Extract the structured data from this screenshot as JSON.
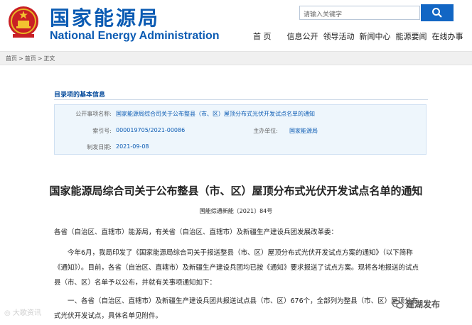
{
  "header": {
    "title_cn": "国家能源局",
    "title_en": "National Energy Administration",
    "search_placeholder": "请输入关键字"
  },
  "nav": {
    "items": [
      "首 页",
      "信息公开",
      "领导活动",
      "新闻中心",
      "能源要闻",
      "在线办事"
    ]
  },
  "breadcrumb": {
    "items": [
      "首页",
      ">",
      "首页",
      ">",
      "正文"
    ]
  },
  "info": {
    "section_title": "目录项的基本信息",
    "subject_label": "公开事项名称:",
    "subject_value": "国家能源局综合司关于公布整县（市、区）屋顶分布式光伏开发试点名单的通知",
    "index_label": "索引号:",
    "index_value": "000019705/2021-00086",
    "issuer_label": "主办单位:",
    "issuer_value": "国家能源局",
    "date_label": "制发日期:",
    "date_value": "2021-09-08"
  },
  "article": {
    "title": "国家能源局综合司关于公布整县（市、区）屋顶分布式光伏开发试点名单的通知",
    "doc_number": "国能综通新能〔2021〕84号",
    "salutation": "各省（自治区、直辖市）能源局，有关省（自治区、直辖市）及新疆生产建设兵团发展改革委：",
    "para1": "今年6月，我局印发了《国家能源局综合司关于报送整县（市、区）屋顶分布式光伏开发试点方案的通知》（以下简称《通知》）。目前，各省（自治区、直辖市）及新疆生产建设兵团均已按《通知》要求报送了试点方案。现将各地报送的试点县（市、区）名单予以公布，并就有关事项通知如下：",
    "para2": "一、各省（自治区、直辖市）及新疆生产建设兵团共报送试点县（市、区）676个，全部列为整县（市、区）屋顶分布式光伏开发试点，具体名单见附件。"
  },
  "watermarks": {
    "left": "大歌资讯",
    "right": "建湖发布"
  },
  "colors": {
    "brand_blue": "#0b5bb3",
    "search_button": "#1266c4",
    "info_box_bg": "#eef6fc"
  }
}
